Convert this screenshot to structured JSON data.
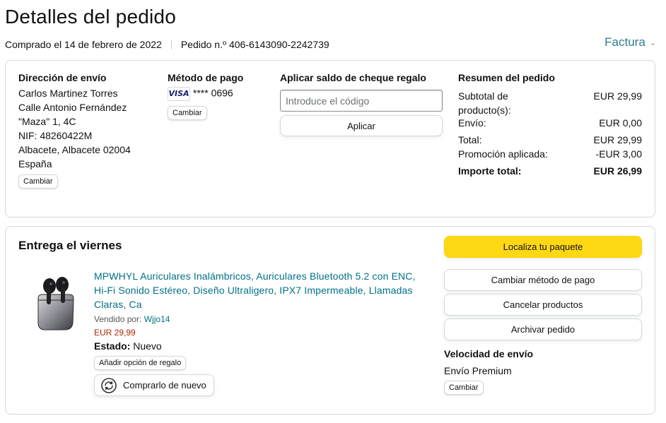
{
  "header": {
    "title": "Detalles del pedido",
    "purchased": "Comprado el 14 de febrero de 2022",
    "order_number": "Pedido n.º 406-6143090-2242739",
    "invoice": "Factura"
  },
  "shipping": {
    "heading": "Dirección de envío",
    "lines": [
      "Carlos Martinez Torres",
      "Calle Antonio Fernández",
      "\"Maza\" 1, 4C",
      "NIF: 48260422M",
      "Albacete, Albacete 02004",
      "España"
    ],
    "change": "Cambiar"
  },
  "payment": {
    "heading": "Método de pago",
    "card_brand": "VISA",
    "card_last": "**** 0696",
    "change": "Cambiar"
  },
  "gift": {
    "heading": "Aplicar saldo de cheque regalo",
    "placeholder": "Introduce el código",
    "apply": "Aplicar"
  },
  "summary": {
    "heading": "Resumen del pedido",
    "subtotal_label_1": "Subtotal de",
    "subtotal_label_2": "producto(s):",
    "subtotal": "EUR 29,99",
    "shipping_label": "Envío:",
    "shipping": "EUR 0,00",
    "total_label": "Total:",
    "total": "EUR 29,99",
    "promo_label": "Promoción aplicada:",
    "promo": "-EUR 3,00",
    "grand_label": "Importe total:",
    "grand": "EUR 26,99"
  },
  "delivery": {
    "heading": "Entrega el viernes",
    "product_lines": [
      "MPWHYL Auriculares Inalámbricos, Auriculares Bluetooth 5.2 con ENC,",
      "Hi-Fi Sonido Estéreo, Diseño Ultraligero, IPX7 Impermeable, Llamadas",
      "Claras, Ca"
    ],
    "sold_by_label": "Vendido por:",
    "seller": "Wjjo14",
    "price": "EUR 29,99",
    "status_label": "Estado:",
    "status": "Nuevo",
    "gift_option": "Añadir opción de regalo",
    "buy_again": "Comprarlo de nuevo",
    "actions": {
      "track": "Localiza tu paquete",
      "change_payment": "Cambiar método de pago",
      "cancel": "Cancelar productos",
      "archive": "Archivar pedido"
    },
    "speed_heading": "Velocidad de envío",
    "speed": "Envío Premium",
    "change": "Cambiar"
  },
  "colors": {
    "link": "#007185",
    "yellow_button": "#FFD814",
    "price": "#B12704"
  }
}
